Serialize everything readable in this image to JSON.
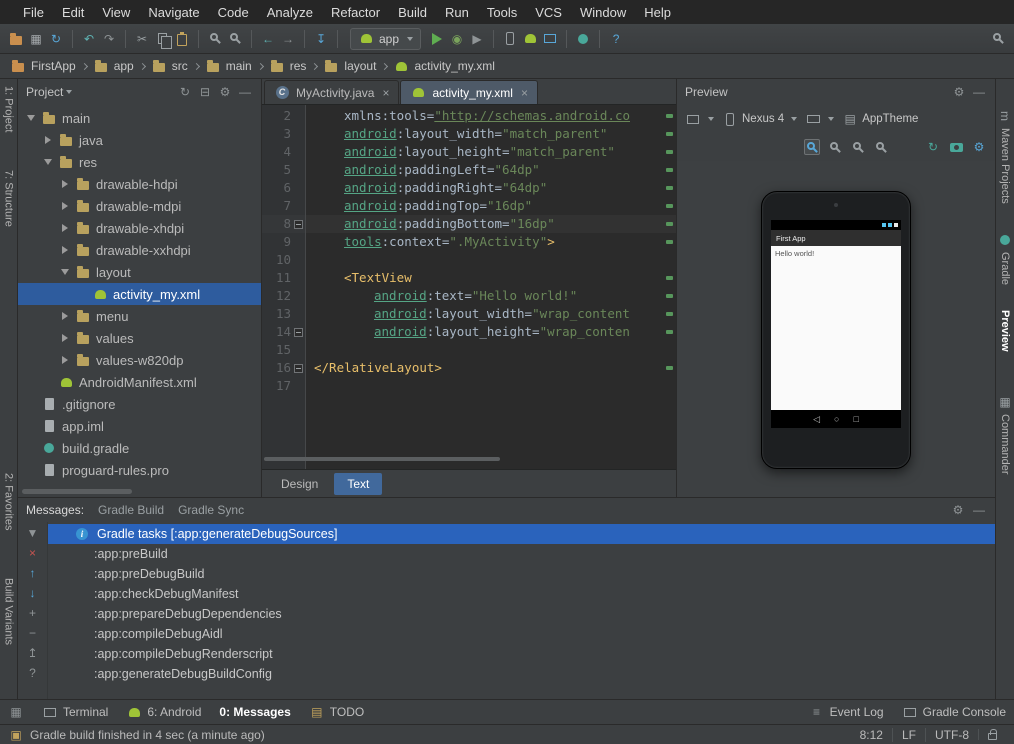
{
  "menubar": {
    "items": [
      "File",
      "Edit",
      "View",
      "Navigate",
      "Code",
      "Analyze",
      "Refactor",
      "Build",
      "Run",
      "Tools",
      "VCS",
      "Window",
      "Help"
    ]
  },
  "toolbar": {
    "left_icons": [
      {
        "name": "open-project-icon",
        "shape": "folder",
        "color": "#c98f4e"
      },
      {
        "name": "save-all-icon",
        "glyph": "▦",
        "color": "#a6abae"
      },
      {
        "name": "sync-icon",
        "glyph": "↻",
        "color": "#58a7d8"
      },
      {
        "name": "separator"
      },
      {
        "name": "undo-icon",
        "glyph": "↶",
        "color": "#5fb3b3"
      },
      {
        "name": "redo-icon",
        "glyph": "↷",
        "color": "#8f9496"
      },
      {
        "name": "separator"
      },
      {
        "name": "cut-icon",
        "glyph": "✂",
        "color": "#9aa0a3"
      },
      {
        "name": "copy-icon",
        "shape": "copy",
        "color": "#9aa0a3"
      },
      {
        "name": "paste-icon",
        "shape": "paste",
        "color": "#c2a35c"
      },
      {
        "name": "separator"
      },
      {
        "name": "find-icon",
        "shape": "zoom",
        "color": "#9aa0a3"
      },
      {
        "name": "replace-icon",
        "shape": "zoom",
        "color": "#9aa0a3"
      },
      {
        "name": "separator"
      },
      {
        "name": "back-icon",
        "glyph": "←",
        "color": "#5fb3b3"
      },
      {
        "name": "forward-icon",
        "glyph": "→",
        "color": "#8f9496"
      },
      {
        "name": "separator"
      },
      {
        "name": "make-project-icon",
        "glyph": "↧",
        "color": "#58a7d8"
      },
      {
        "name": "separator"
      }
    ],
    "run_config": {
      "label": "app",
      "icon": {
        "name": "android-run-config-icon",
        "shape": "android",
        "color": "#9fc437"
      }
    },
    "right_icons": [
      {
        "name": "run-icon",
        "shape": "run",
        "color": "#5fad51"
      },
      {
        "name": "debug-icon",
        "glyph": "◉",
        "color": "#7aa35c"
      },
      {
        "name": "coverage-icon",
        "glyph": "▶",
        "color": "#8f9496"
      },
      {
        "name": "separator"
      },
      {
        "name": "avd-manager-icon",
        "shape": "phone",
        "color": "#9aa0a3"
      },
      {
        "name": "sdk-manager-icon",
        "shape": "android",
        "color": "#9fc437"
      },
      {
        "name": "device-monitor-icon",
        "shape": "monitor",
        "color": "#58a7d8"
      },
      {
        "name": "separator"
      },
      {
        "name": "gradle-sync-icon",
        "shape": "gradle",
        "color": "#49a89a"
      },
      {
        "name": "separator"
      },
      {
        "name": "help-icon",
        "glyph": "?",
        "color": "#58a7d8"
      }
    ],
    "search_icon": {
      "name": "search-everywhere-icon",
      "shape": "zoom",
      "color": "#9aa0a3"
    }
  },
  "breadcrumbs": {
    "items": [
      {
        "label": "FirstApp",
        "icon": {
          "name": "project-folder-icon",
          "shape": "folder",
          "color": "#c98f4e"
        }
      },
      {
        "label": "app",
        "icon": {
          "name": "folder-icon",
          "shape": "folder",
          "color": "#b8a15e"
        }
      },
      {
        "label": "src",
        "icon": {
          "name": "folder-icon",
          "shape": "folder",
          "color": "#b8a15e"
        }
      },
      {
        "label": "main",
        "icon": {
          "name": "folder-icon",
          "shape": "folder",
          "color": "#b8a15e"
        }
      },
      {
        "label": "res",
        "icon": {
          "name": "folder-icon",
          "shape": "folder",
          "color": "#b8a15e"
        }
      },
      {
        "label": "layout",
        "icon": {
          "name": "folder-icon",
          "shape": "folder",
          "color": "#b8a15e"
        }
      },
      {
        "label": "activity_my.xml",
        "icon": {
          "name": "android-file-icon",
          "shape": "android",
          "color": "#9fc437"
        }
      }
    ]
  },
  "left_strip": {
    "items": [
      {
        "label": "1: Project"
      },
      {
        "label": "7: Structure"
      },
      {
        "label": "2: Favorites"
      },
      {
        "label": "Build Variants"
      }
    ]
  },
  "right_strip": {
    "items": [
      {
        "label": "Maven Projects",
        "icon": {
          "name": "maven-icon",
          "glyph": "m",
          "color": "#9aa0a3"
        }
      },
      {
        "label": "Gradle",
        "icon": {
          "name": "gradle-icon",
          "shape": "gradle",
          "color": "#49a89a"
        }
      },
      {
        "label": "Preview",
        "active": true
      },
      {
        "label": "Commander",
        "icon": {
          "name": "commander-icon",
          "glyph": "▦",
          "color": "#9aa0a3"
        }
      }
    ]
  },
  "project": {
    "title": "Project",
    "header_icons": [
      {
        "name": "sync-icon",
        "glyph": "↻",
        "color": "#8f9496"
      },
      {
        "name": "collapse-all-icon",
        "glyph": "⊟",
        "color": "#8f9496"
      },
      {
        "name": "settings-icon",
        "glyph": "⚙",
        "color": "#8f9496"
      },
      {
        "name": "hide-icon",
        "glyph": "—",
        "color": "#8f9496"
      }
    ],
    "tree": [
      {
        "label": "main",
        "level": 0,
        "arrow": "open",
        "icon": "folder"
      },
      {
        "label": "java",
        "level": 1,
        "arrow": "closed",
        "icon": "folder"
      },
      {
        "label": "res",
        "level": 1,
        "arrow": "open",
        "icon": "folder"
      },
      {
        "label": "drawable-hdpi",
        "level": 2,
        "arrow": "closed",
        "icon": "folder"
      },
      {
        "label": "drawable-mdpi",
        "level": 2,
        "arrow": "closed",
        "icon": "folder"
      },
      {
        "label": "drawable-xhdpi",
        "level": 2,
        "arrow": "closed",
        "icon": "folder"
      },
      {
        "label": "drawable-xxhdpi",
        "level": 2,
        "arrow": "closed",
        "icon": "folder"
      },
      {
        "label": "layout",
        "level": 2,
        "arrow": "open",
        "icon": "folder"
      },
      {
        "label": "activity_my.xml",
        "level": 3,
        "arrow": "none",
        "icon": "android",
        "selected": true
      },
      {
        "label": "menu",
        "level": 2,
        "arrow": "closed",
        "icon": "folder"
      },
      {
        "label": "values",
        "level": 2,
        "arrow": "closed",
        "icon": "folder"
      },
      {
        "label": "values-w820dp",
        "level": 2,
        "arrow": "closed",
        "icon": "folder"
      },
      {
        "label": "AndroidManifest.xml",
        "level": 1,
        "arrow": "none",
        "icon": "android"
      },
      {
        "label": ".gitignore",
        "level": 0,
        "arrow": "none",
        "icon": "file"
      },
      {
        "label": "app.iml",
        "level": 0,
        "arrow": "none",
        "icon": "file"
      },
      {
        "label": "build.gradle",
        "level": 0,
        "arrow": "none",
        "icon": "gradle"
      },
      {
        "label": "proguard-rules.pro",
        "level": 0,
        "arrow": "none",
        "icon": "file"
      }
    ]
  },
  "editor": {
    "tabs": [
      {
        "label": "MyActivity.java",
        "active": false,
        "icon": {
          "name": "java-class-icon",
          "shape": "class",
          "letter": "C"
        }
      },
      {
        "label": "activity_my.xml",
        "active": true,
        "icon": {
          "name": "android-file-icon",
          "shape": "android",
          "color": "#9fc437"
        }
      }
    ],
    "close_glyph": "×",
    "lines": [
      {
        "num": 2,
        "indent": 1,
        "changed": true,
        "seg": [
          [
            "attr",
            "xmlns:tools"
          ],
          [
            "pln",
            "="
          ],
          [
            "stru",
            "\"http://schemas.android.co"
          ]
        ]
      },
      {
        "num": 3,
        "indent": 1,
        "changed": true,
        "seg": [
          [
            "ns",
            "android"
          ],
          [
            "attr",
            ":layout_width"
          ],
          [
            "pln",
            "="
          ],
          [
            "str",
            "\"match_parent\""
          ]
        ]
      },
      {
        "num": 4,
        "indent": 1,
        "changed": true,
        "seg": [
          [
            "ns",
            "android"
          ],
          [
            "attr",
            ":layout_height"
          ],
          [
            "pln",
            "="
          ],
          [
            "str",
            "\"match_parent\""
          ]
        ]
      },
      {
        "num": 5,
        "indent": 1,
        "changed": true,
        "seg": [
          [
            "ns",
            "android"
          ],
          [
            "attr",
            ":paddingLeft"
          ],
          [
            "pln",
            "="
          ],
          [
            "str",
            "\"64dp\""
          ]
        ]
      },
      {
        "num": 6,
        "indent": 1,
        "changed": true,
        "seg": [
          [
            "ns",
            "android"
          ],
          [
            "attr",
            ":paddingRight"
          ],
          [
            "pln",
            "="
          ],
          [
            "str",
            "\"64dp\""
          ]
        ]
      },
      {
        "num": 7,
        "indent": 1,
        "changed": true,
        "seg": [
          [
            "ns",
            "android"
          ],
          [
            "attr",
            ":paddingTop"
          ],
          [
            "pln",
            "="
          ],
          [
            "str",
            "\"16dp\""
          ]
        ]
      },
      {
        "num": 8,
        "indent": 1,
        "changed": true,
        "current": true,
        "fold": true,
        "seg": [
          [
            "ns",
            "android"
          ],
          [
            "attr",
            ":paddingBottom"
          ],
          [
            "pln",
            "="
          ],
          [
            "str",
            "\"16dp\""
          ]
        ]
      },
      {
        "num": 9,
        "indent": 1,
        "changed": true,
        "seg": [
          [
            "ns",
            "tools"
          ],
          [
            "attr",
            ":context"
          ],
          [
            "pln",
            "="
          ],
          [
            "str",
            "\".MyActivity\""
          ],
          [
            "tag",
            ">"
          ]
        ]
      },
      {
        "num": 10,
        "indent": 0,
        "seg": []
      },
      {
        "num": 11,
        "indent": 1,
        "changed": true,
        "seg": [
          [
            "tag",
            "<TextView"
          ]
        ]
      },
      {
        "num": 12,
        "indent": 2,
        "changed": true,
        "seg": [
          [
            "ns",
            "android"
          ],
          [
            "attr",
            ":text"
          ],
          [
            "pln",
            "="
          ],
          [
            "str",
            "\"Hello world!\""
          ]
        ]
      },
      {
        "num": 13,
        "indent": 2,
        "changed": true,
        "seg": [
          [
            "ns",
            "android"
          ],
          [
            "attr",
            ":layout_width"
          ],
          [
            "pln",
            "="
          ],
          [
            "str",
            "\"wrap_content"
          ]
        ]
      },
      {
        "num": 14,
        "indent": 2,
        "changed": true,
        "fold": true,
        "seg": [
          [
            "ns",
            "android"
          ],
          [
            "attr",
            ":layout_height"
          ],
          [
            "pln",
            "="
          ],
          [
            "str",
            "\"wrap_conten"
          ]
        ]
      },
      {
        "num": 15,
        "indent": 0,
        "seg": []
      },
      {
        "num": 16,
        "indent": 0,
        "changed": true,
        "fold": true,
        "seg": [
          [
            "tag",
            "</RelativeLayout>"
          ]
        ]
      },
      {
        "num": 17,
        "indent": 0,
        "seg": []
      }
    ],
    "bottom_tabs": [
      {
        "label": "Design",
        "active": false
      },
      {
        "label": "Text",
        "active": true
      }
    ]
  },
  "preview": {
    "title": "Preview",
    "header_icons": [
      {
        "name": "settings-icon",
        "glyph": "⚙",
        "color": "#8f9496"
      },
      {
        "name": "hide-icon",
        "glyph": "—",
        "color": "#8f9496"
      }
    ],
    "toolbar": {
      "config_icon": {
        "name": "configuration-icon",
        "shape": "monitor",
        "color": "#9aa0a3"
      },
      "device": {
        "label": "Nexus 4",
        "icon": {
          "name": "device-icon",
          "shape": "phone",
          "color": "#9aa0a3"
        }
      },
      "orientation_icon": {
        "name": "orientation-icon",
        "shape": "landscape",
        "color": "#9aa0a3"
      },
      "theme": {
        "label": "AppTheme",
        "icon": {
          "name": "theme-icon",
          "glyph": "▤",
          "color": "#9aa0a3"
        }
      }
    },
    "zoom_icons": [
      {
        "name": "zoom-fit-icon",
        "shape": "zoom",
        "color": "#58a7d8",
        "boxed": true
      },
      {
        "name": "actual-size-icon",
        "shape": "zoom",
        "color": "#9aa0a3"
      },
      {
        "name": "zoom-in-icon",
        "shape": "zoom",
        "color": "#9aa0a3"
      },
      {
        "name": "zoom-out-icon",
        "shape": "zoom",
        "color": "#9aa0a3"
      }
    ],
    "action_icons": [
      {
        "name": "refresh-preview-icon",
        "glyph": "↻",
        "color": "#49a89a"
      },
      {
        "name": "screenshot-icon",
        "shape": "camera",
        "color": "#49a89a"
      },
      {
        "name": "preview-settings-icon",
        "glyph": "⚙",
        "color": "#58a7d8"
      }
    ],
    "phone": {
      "app_title": "First App",
      "content_text": "Hello world!",
      "nav_icons": [
        {
          "name": "back-nav-icon",
          "glyph": "◁"
        },
        {
          "name": "home-nav-icon",
          "glyph": "○"
        },
        {
          "name": "recents-nav-icon",
          "glyph": "□"
        }
      ]
    }
  },
  "messages": {
    "label": "Messages:",
    "tabs": [
      "Gradle Build",
      "Gradle Sync"
    ],
    "header_icons": [
      {
        "name": "settings-icon",
        "glyph": "⚙",
        "color": "#8f9496"
      },
      {
        "name": "hide-icon",
        "glyph": "—",
        "color": "#8f9496"
      }
    ],
    "tool_icons": [
      {
        "name": "filter-icon",
        "glyph": "▼",
        "color": "#8f9496"
      },
      {
        "name": "close-icon",
        "glyph": "×",
        "color": "#c75450"
      },
      {
        "name": "up-icon",
        "glyph": "↑",
        "color": "#58a7d8"
      },
      {
        "name": "down-icon",
        "glyph": "↓",
        "color": "#58a7d8"
      },
      {
        "name": "expand-all-icon",
        "glyph": "+",
        "color": "#8f9496"
      },
      {
        "name": "collapse-all-icon",
        "glyph": "−",
        "color": "#8f9496"
      },
      {
        "name": "export-icon",
        "glyph": "↥",
        "color": "#8f9496"
      },
      {
        "name": "help-icon",
        "glyph": "?",
        "color": "#8f9496"
      }
    ],
    "rows": [
      {
        "text": "Gradle tasks [:app:generateDebugSources]",
        "selected": true,
        "info": true
      },
      {
        "text": ":app:preBuild"
      },
      {
        "text": ":app:preDebugBuild"
      },
      {
        "text": ":app:checkDebugManifest"
      },
      {
        "text": ":app:prepareDebugDependencies"
      },
      {
        "text": ":app:compileDebugAidl"
      },
      {
        "text": ":app:compileDebugRenderscript"
      },
      {
        "text": ":app:generateDebugBuildConfig"
      }
    ]
  },
  "bottom_bar": {
    "left": [
      {
        "name": "tool-switcher-icon",
        "icon": {
          "name": "tool-switcher-icon",
          "glyph": "▦",
          "color": "#8f9496"
        }
      },
      {
        "name": "terminal-button",
        "label": "Terminal",
        "icon": {
          "name": "terminal-icon",
          "shape": "monitor",
          "color": "#9aa0a3"
        }
      },
      {
        "name": "android-button",
        "label": "6: Android",
        "icon": {
          "name": "android-icon",
          "shape": "android",
          "color": "#9fc437"
        }
      },
      {
        "name": "messages-button",
        "label": "0: Messages",
        "active": true,
        "icon": {
          "name": "messages-icon",
          "glyph": "⚙",
          "color": "#c2a35c"
        }
      },
      {
        "name": "todo-button",
        "label": "TODO",
        "icon": {
          "name": "todo-icon",
          "glyph": "▤",
          "color": "#c2a35c"
        }
      }
    ],
    "right": [
      {
        "name": "event-log-button",
        "label": "Event Log",
        "icon": {
          "name": "event-log-icon",
          "glyph": "≡",
          "color": "#8f9496"
        }
      },
      {
        "name": "gradle-console-button",
        "label": "Gradle Console",
        "icon": {
          "name": "console-icon",
          "shape": "monitor",
          "color": "#9aa0a3"
        }
      }
    ]
  },
  "status_bar": {
    "icon": {
      "name": "status-indicator-icon",
      "glyph": "▣",
      "color": "#c2a35c"
    },
    "message": "Gradle build finished in 4 sec (a minute ago)",
    "caret_position": "8:12",
    "line_separator": "LF",
    "encoding": "UTF-8"
  }
}
